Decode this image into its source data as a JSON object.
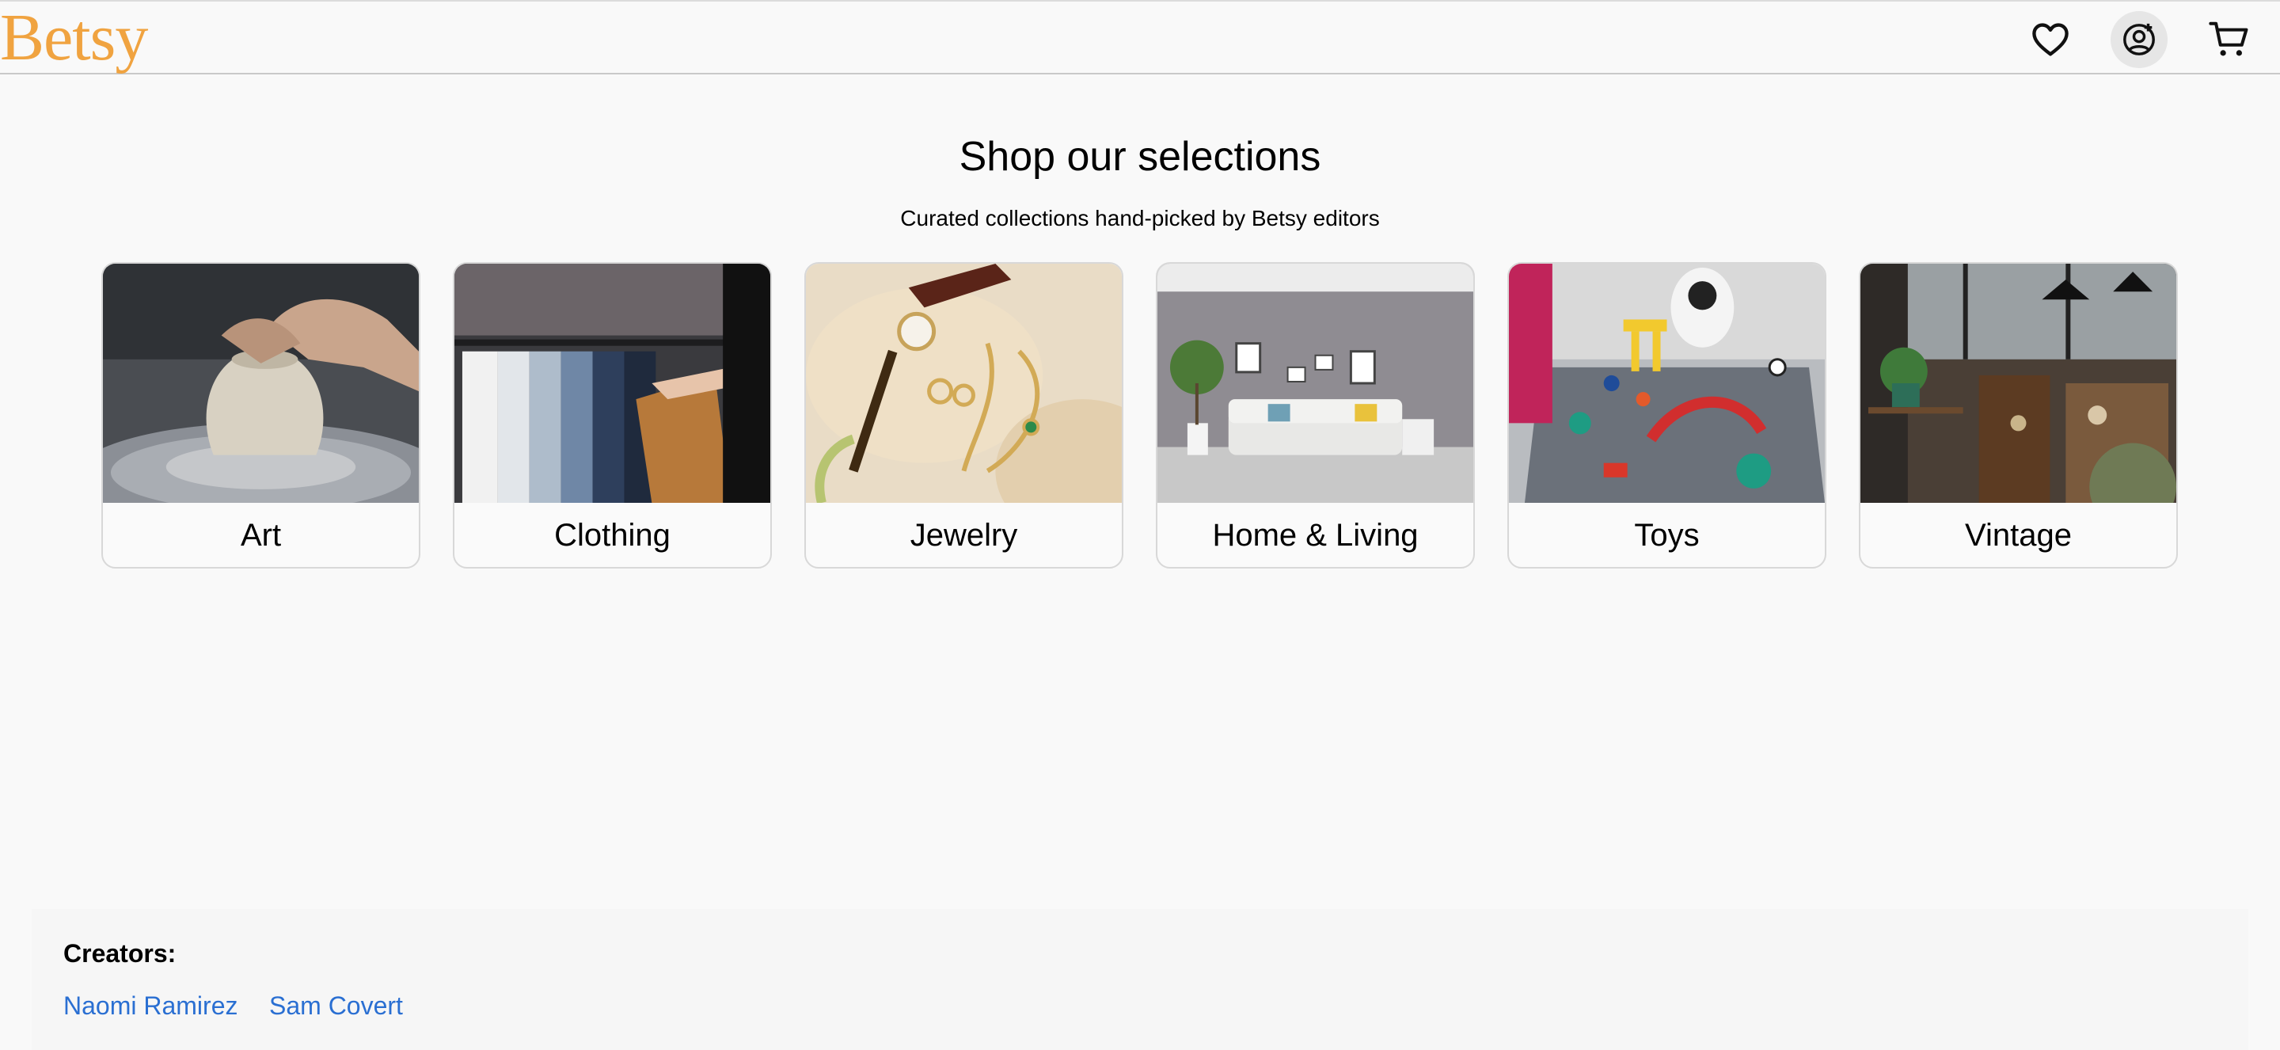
{
  "header": {
    "logo": "Betsy",
    "icons": [
      "heart-icon",
      "user-icon",
      "cart-icon"
    ]
  },
  "hero": {
    "title": "Shop our selections",
    "subtitle": "Curated collections hand-picked by Betsy editors"
  },
  "categories": [
    {
      "label": "Art"
    },
    {
      "label": "Clothing"
    },
    {
      "label": "Jewelry"
    },
    {
      "label": "Home & Living"
    },
    {
      "label": "Toys"
    },
    {
      "label": "Vintage"
    }
  ],
  "footer": {
    "title": "Creators:",
    "links": [
      "Naomi Ramirez",
      "Sam Covert"
    ]
  },
  "colors": {
    "logo": "#f0a340",
    "link": "#2a6fd2",
    "background": "#f9f9f9"
  }
}
